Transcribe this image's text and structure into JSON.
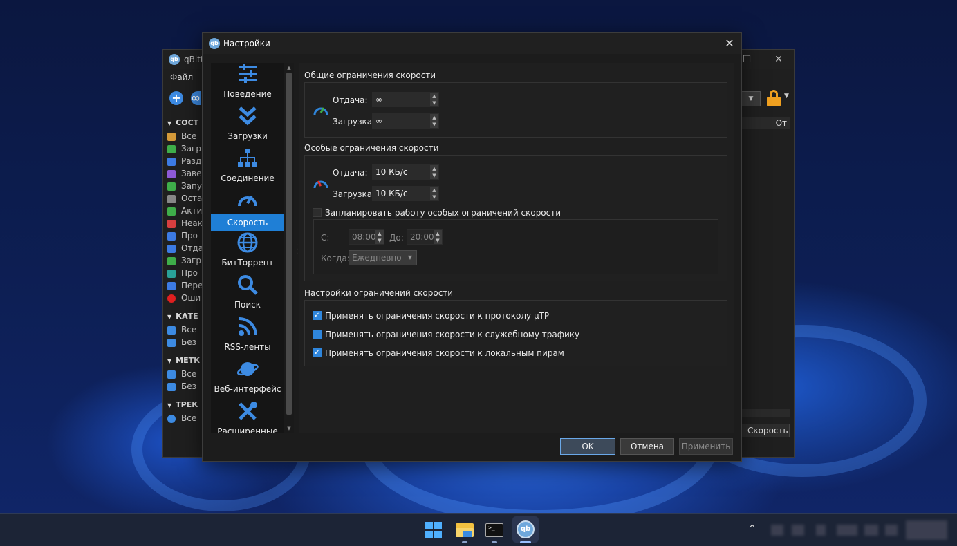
{
  "main_window": {
    "title": "qBitto",
    "menu": [
      "Файл",
      "П"
    ],
    "sidebar": {
      "sections": [
        {
          "header": "СОСТ",
          "items": [
            "Все",
            "Загр",
            "Разд",
            "Заве",
            "Запу",
            "Оста",
            "Акти",
            "Неак",
            "Про",
            "Отда",
            "Загр",
            "Про",
            "Пере",
            "Оши"
          ]
        },
        {
          "header": "КАТЕ",
          "items": [
            "Все",
            "Без"
          ]
        },
        {
          "header": "МЕТК",
          "items": [
            "Все",
            "Без"
          ]
        },
        {
          "header": "ТРЕК",
          "items": [
            "Все"
          ]
        }
      ]
    },
    "column_header": "От",
    "status_speed": "Скорость"
  },
  "dialog": {
    "title": "Настройки",
    "nav": [
      {
        "label": "Поведение",
        "icon": "sliders-icon"
      },
      {
        "label": "Загрузки",
        "icon": "double-chevron-down-icon"
      },
      {
        "label": "Соединение",
        "icon": "network-icon"
      },
      {
        "label": "Скорость",
        "icon": "speedometer-icon",
        "active": true
      },
      {
        "label": "БитТоррент",
        "icon": "globe-icon"
      },
      {
        "label": "Поиск",
        "icon": "magnifier-icon"
      },
      {
        "label": "RSS-ленты",
        "icon": "rss-icon"
      },
      {
        "label": "Веб-интерфейс",
        "icon": "planet-icon"
      },
      {
        "label": "Расширенные",
        "icon": "tools-icon"
      }
    ],
    "global_limits": {
      "title": "Общие ограничения скорости",
      "upload_label": "Отдача:",
      "upload_value": "∞",
      "download_label": "Загрузка:",
      "download_value": "∞"
    },
    "alt_limits": {
      "title": "Особые ограничения скорости",
      "upload_label": "Отдача:",
      "upload_value": "10 КБ/с",
      "download_label": "Загрузка:",
      "download_value": "10 КБ/с",
      "schedule_label": "Запланировать работу особых ограничений скорости",
      "schedule_checked": false,
      "from_label": "С:",
      "from_value": "08:00",
      "to_label": "До:",
      "to_value": "20:00",
      "when_label": "Когда:",
      "when_value": "Ежедневно"
    },
    "limit_settings": {
      "title": "Настройки ограничений скорости",
      "options": [
        {
          "label": "Применять ограничения скорости к протоколу µTP",
          "state": "checked"
        },
        {
          "label": "Применять ограничения скорости к служебному трафику",
          "state": "partial"
        },
        {
          "label": "Применять ограничения скорости к локальным пирам",
          "state": "checked"
        }
      ]
    },
    "buttons": {
      "ok": "OK",
      "cancel": "Отмена",
      "apply": "Применить"
    }
  },
  "colors": {
    "accent": "#1f7fd6",
    "icon_blue": "#3d8be3"
  }
}
